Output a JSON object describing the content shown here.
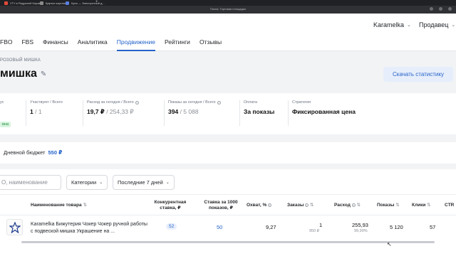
{
  "browser": {
    "tabs": [
      {
        "label": "УТУ в Радужной Корзине",
        "icon": "red-favicon"
      },
      {
        "label": "Крутые картинки",
        "icon": "gray-favicon"
      },
      {
        "label": "Купи — Электронный д...",
        "icon": "blue-favicon"
      }
    ],
    "window_title": "Поиск: Торговая площадка"
  },
  "header": {
    "account": "Karamelka",
    "role": "Продавец",
    "nav": [
      "FBO",
      "FBS",
      "Финансы",
      "Аналитика",
      "Продвижение",
      "Рейтинги",
      "Отзывы"
    ],
    "active_nav": "Продвижение"
  },
  "campaign": {
    "breadcrumb": "РОЗОВЫЙ МИШКА",
    "title": "мишка",
    "download_label": "Скачать статистику",
    "status_label_tail": "ус",
    "status_badge": "вна",
    "stats": [
      {
        "label": "Участвуют / Всего",
        "value": "1",
        "sub": "/ 1"
      },
      {
        "label": "Расход за сегодня / Всего",
        "value": "19,7 ₽",
        "sub": "/ 254,33 ₽"
      },
      {
        "label": "Показы за сегодня / Всего",
        "value": "394",
        "sub": "/ 5 088"
      },
      {
        "label": "Оплата",
        "value": "За показы",
        "sub": ""
      },
      {
        "label": "Стратегия",
        "value": "Фиксированная цена",
        "sub": ""
      }
    ],
    "budget_label": "Дневной бюджет",
    "budget_value": "550 ₽"
  },
  "filters": {
    "search_placeholder": "О, наименование",
    "categories": "Категории",
    "period": "Последние 7 дней"
  },
  "table": {
    "columns": {
      "name": "Наименование товара",
      "competitor": "Конкурентная ставка, ₽",
      "bid": "Ставка за 1000 показов, ₽",
      "reach": "Охват, %",
      "orders": "Заказы",
      "spend": "Расход",
      "impressions": "Показы",
      "clicks": "Клики",
      "ctr": "CTR"
    },
    "rows": [
      {
        "name": "Karamelka Бижутерия Чокер Чокер ручной работы с подвеской мишка Украшение на ...",
        "competitor": "52",
        "bid": "50",
        "reach": "9,27",
        "orders": "1",
        "orders_sub": "950 ₽",
        "spend": "255,93",
        "spend_sub": "99,99%",
        "impressions": "5 120",
        "clicks": "57"
      }
    ]
  }
}
